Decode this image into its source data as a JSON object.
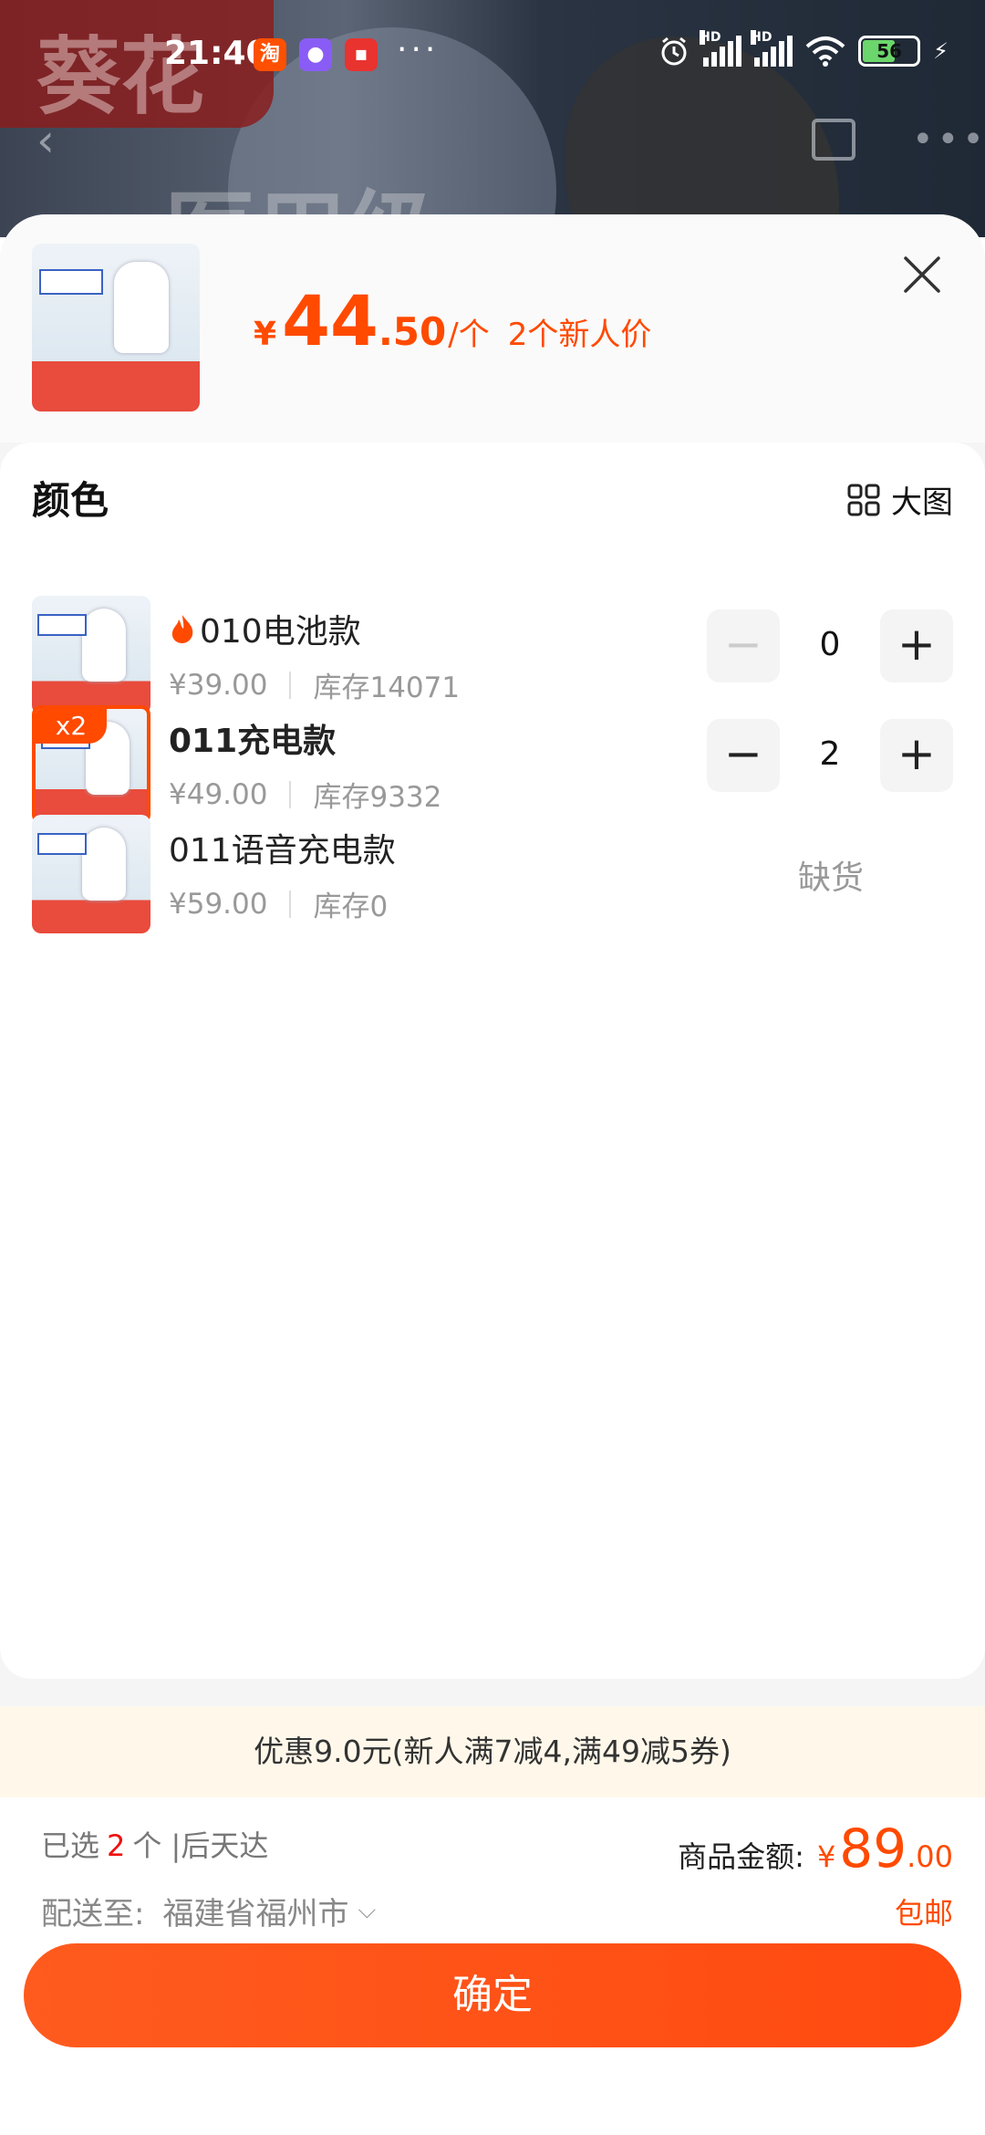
{
  "status_bar": {
    "time": "21:40",
    "battery": "56"
  },
  "header": {
    "price_symbol": "¥",
    "price_int": "44",
    "price_dec": ".50",
    "price_unit": "/个",
    "price_note": "2个新人价"
  },
  "section": {
    "title": "颜色",
    "big_image_label": "大图"
  },
  "items": [
    {
      "name": "010电池款",
      "price": "¥39.00",
      "stock": "库存14071",
      "qty": "0"
    },
    {
      "name": "011充电款",
      "price": "¥49.00",
      "stock": "库存9332",
      "qty": "2",
      "badge": "x2"
    },
    {
      "name": "011语音充电款",
      "price": "¥59.00",
      "stock": "库存0",
      "status": "缺货"
    }
  ],
  "promo": {
    "text": "优惠9.0元(新人满7减4,满49减5券)"
  },
  "summary": {
    "selected_prefix": "已选",
    "selected_count": "2",
    "selected_suffix": "个 |后天达",
    "amount_label": "商品金额:",
    "amount_symbol": "¥",
    "amount_int": "89",
    "amount_dec": ".00",
    "ship_label": "配送至:",
    "ship_location": "福建省福州市",
    "free_shipping": "包邮"
  },
  "confirm_button": {
    "label": "确定"
  },
  "colors": {
    "accent": "#ff4a00",
    "promo_bg": "#fff8ea"
  }
}
